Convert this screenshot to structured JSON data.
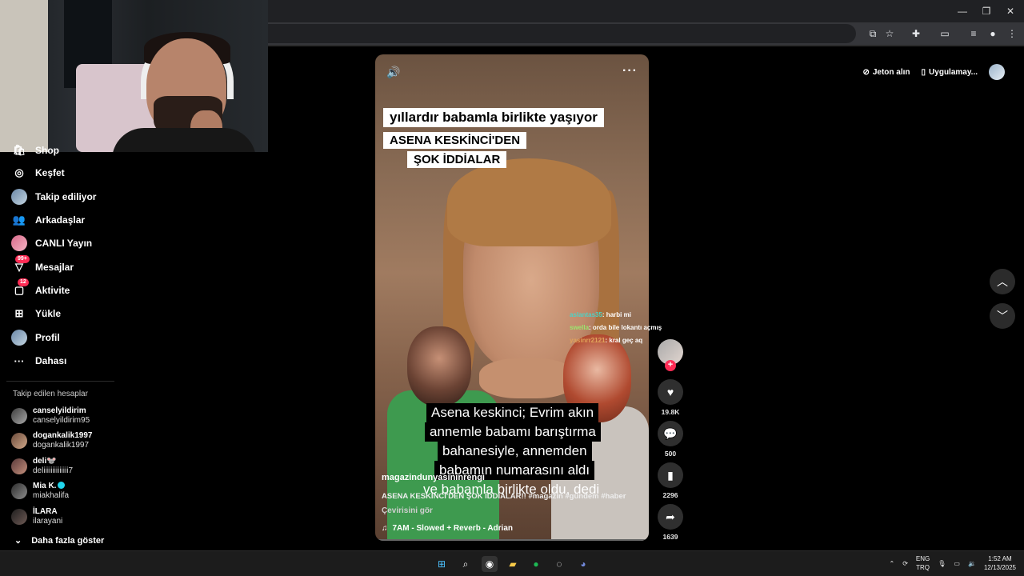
{
  "sidebar": {
    "items": [
      {
        "label": "Shop",
        "icon": "shop-icon"
      },
      {
        "label": "Keşfet",
        "icon": "compass-icon"
      },
      {
        "label": "Takip ediliyor",
        "icon": "following-icon"
      },
      {
        "label": "Arkadaşlar",
        "icon": "friends-icon"
      },
      {
        "label": "CANLI Yayın",
        "icon": "live-icon"
      },
      {
        "label": "Mesajlar",
        "icon": "messages-icon",
        "badge": "99+"
      },
      {
        "label": "Aktivite",
        "icon": "activity-icon",
        "badge": "12"
      },
      {
        "label": "Yükle",
        "icon": "upload-icon"
      },
      {
        "label": "Profil",
        "icon": "profile-icon"
      },
      {
        "label": "Dahası",
        "icon": "more-icon"
      }
    ],
    "following_title": "Takip edilen hesaplar",
    "accounts": [
      {
        "name": "canselyildirim",
        "username": "canselyildirim95"
      },
      {
        "name": "dogankalik1997",
        "username": "dogankalik1997"
      },
      {
        "name": "deli🐭",
        "username": "deliiiiiiiiiiiiii7"
      },
      {
        "name": "Mia K.",
        "username": "miakhalifa"
      },
      {
        "name": "İLARA",
        "username": "ilarayani"
      }
    ],
    "show_more": "Daha fazla göster"
  },
  "video": {
    "caption_line1": "yıllardır babamla birlikte yaşıyor",
    "caption_line2": "ASENA KESKİNCİ'DEN",
    "caption_line3": "ŞOK İDDİALAR",
    "subtitle_line1": "Asena keskinci; Evrim akın",
    "subtitle_line2": "annemle babamı barıştırma",
    "subtitle_line3": "bahanesiyle, annemden",
    "subtitle_line4": "babamın numarasını aldı",
    "subtitle_line5": "ve babamla birlikte oldu, dedi",
    "author": "magazindunyasininrengi",
    "description": "ASENA KESKİNCİ'DEN ŞOK İDDİALAR!! #magazin #gündem #haber",
    "translate": "Çevirisini gör",
    "music": "7AM - Slowed + Reverb - Adrian"
  },
  "chat": [
    {
      "user": "aslantas35",
      "text": ": harbi mi",
      "color": "#4fd1c5"
    },
    {
      "user": "swella",
      "text": ": orda bile lokantı açmış",
      "color": "#9ae66e"
    },
    {
      "user": "yasinrr2121",
      "text": ": kral geç aq",
      "color": "#e0a35a"
    }
  ],
  "actions": {
    "likes": "19.8K",
    "comments": "500",
    "saves": "2296",
    "shares": "1639"
  },
  "topbar": {
    "coins": "Jeton alın",
    "app": "Uygulamay..."
  },
  "tray": {
    "lang1": "ENG",
    "lang2": "TRQ",
    "time": "1:52 AM",
    "date": "12/13/2025"
  },
  "colors": {
    "accent": "#fe2c55",
    "background": "#000000"
  }
}
